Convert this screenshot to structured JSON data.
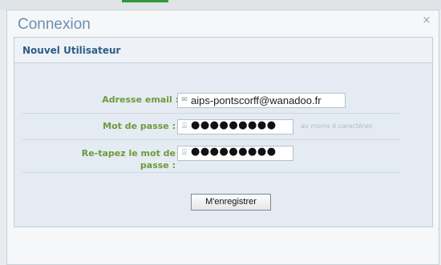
{
  "dialog": {
    "title": "Connexion",
    "close_glyph": "×",
    "panel_title": "Nouvel Utilisateur"
  },
  "form": {
    "email_label": "Adresse email :",
    "email_icon": "mail-icon",
    "email_value": "aips-pontscorff@wanadoo.fr",
    "password_label": "Mot de passe :",
    "password_icon": "lock-icon",
    "password_value": "●●●●●●●●●",
    "password_hint": "au moins 6 caractères",
    "retype_label_line1": "Re-tapez le mot de",
    "retype_label_line2": "passe :",
    "retype_icon": "lock-icon",
    "retype_value": "●●●●●●●●●",
    "submit_label": "M'enregistrer"
  },
  "colors": {
    "title": "#6b8fb3",
    "panel_title": "#2e5c8a",
    "labels": "#6e9a3c"
  }
}
